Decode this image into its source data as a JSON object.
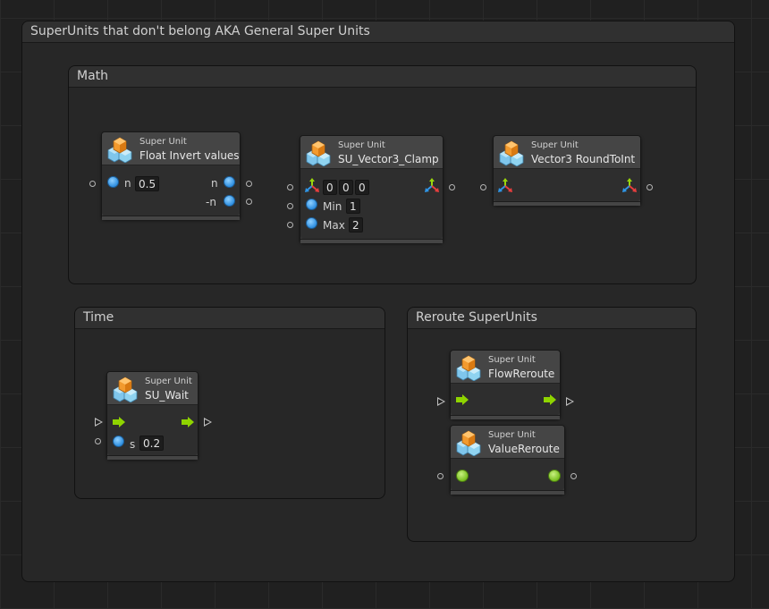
{
  "groups": {
    "general": "SuperUnits that don't belong AKA General Super Units",
    "math": "Math",
    "time": "Time",
    "reroute": "Reroute SuperUnits"
  },
  "node_kind": "Super Unit",
  "nodes": {
    "float_invert": {
      "title": "Float Invert values",
      "in_label": "n",
      "in_value": "0.5",
      "out1": "n",
      "out2": "-n"
    },
    "clamp": {
      "title": "SU_Vector3_Clamp",
      "x": "0",
      "y": "0",
      "z": "0",
      "min_label": "Min",
      "min_value": "1",
      "max_label": "Max",
      "max_value": "2"
    },
    "round": {
      "title": "Vector3 RoundToInt"
    },
    "wait": {
      "title": "SU_Wait",
      "s_label": "s",
      "s_value": "0.2"
    },
    "flow_reroute": {
      "title": "FlowReroute"
    },
    "value_reroute": {
      "title": "ValueReroute"
    }
  },
  "colors": {
    "value_port": "#3d9be9",
    "flow_arrow": "#8fd400",
    "any_port": "#7cc427",
    "group_bg": "#272727",
    "node_head": "#454545"
  },
  "icons": {
    "node": "super-unit-cubes-icon",
    "vector3": "vector3-axes-icon",
    "flow": "flow-arrow-icon"
  }
}
